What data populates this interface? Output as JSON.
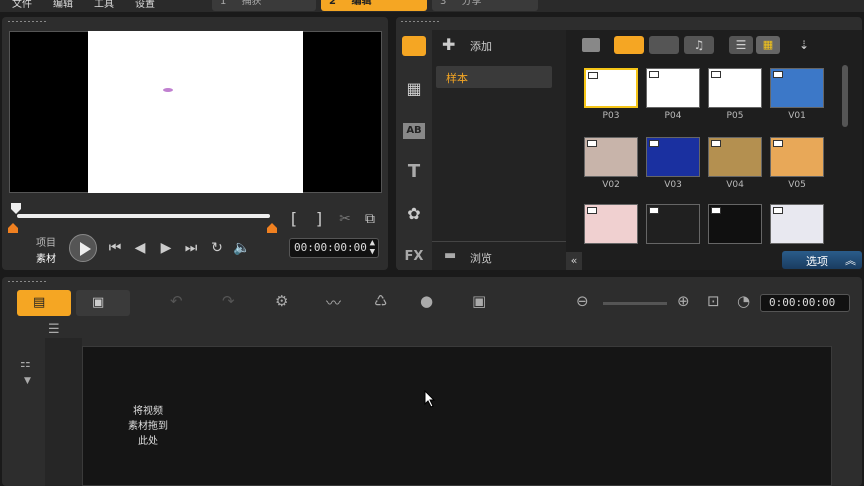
{
  "menu": {
    "items": [
      "文件",
      "编辑",
      "工具",
      "设置"
    ],
    "steps": [
      {
        "num": "1",
        "label": "捕获"
      },
      {
        "num": "2",
        "label": "编辑"
      },
      {
        "num": "3",
        "label": "分享"
      }
    ]
  },
  "preview": {
    "mode_project": "项目",
    "mode_clip": "素材",
    "timecode": "00:00:00:00",
    "mark_in": "[",
    "mark_out": "]"
  },
  "library": {
    "add_label": "添加",
    "folder_item": "样本",
    "browse_label": "浏览",
    "options_label": "选项",
    "thumbnails": [
      {
        "label": "P03",
        "color": "#ffffff",
        "selected": true
      },
      {
        "label": "P04",
        "color": "#ffffff"
      },
      {
        "label": "P05",
        "color": "#ffffff"
      },
      {
        "label": "V01",
        "color": "#3c78c8"
      },
      {
        "label": "V02",
        "color": "#c8b4aa"
      },
      {
        "label": "V03",
        "color": "#1a30a0"
      },
      {
        "label": "V04",
        "color": "#b49050"
      },
      {
        "label": "V05",
        "color": "#e8a858"
      },
      {
        "label": "",
        "color": "#f0d0d0"
      },
      {
        "label": "",
        "color": "#202020"
      },
      {
        "label": "",
        "color": "#101010"
      },
      {
        "label": "",
        "color": "#e8e8f0"
      }
    ]
  },
  "timeline": {
    "timecode": "0:00:00:00",
    "drop_hint": "将视频\n素材拖到\n此处"
  },
  "colors": {
    "accent": "#f5a623",
    "panel": "#2d2d2d"
  }
}
